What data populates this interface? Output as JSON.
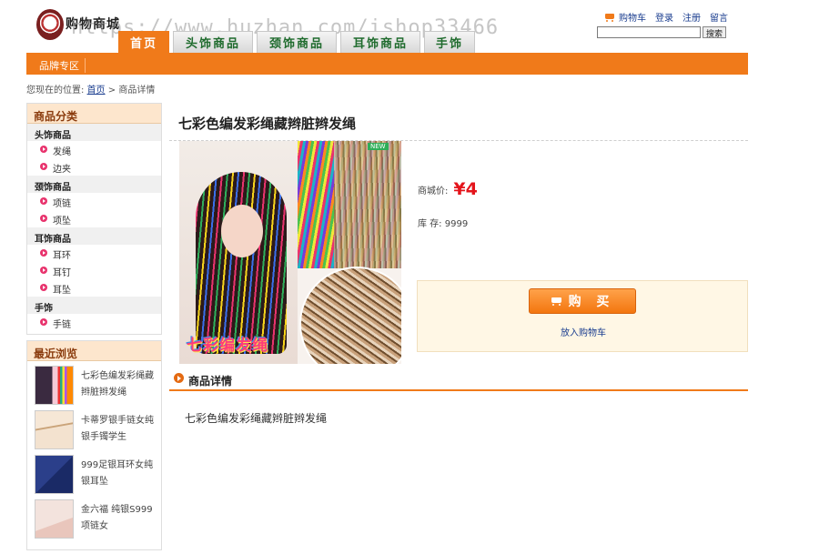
{
  "header": {
    "brand": "购物商城",
    "watermark": "https://www.huzhan.com/ishop33466",
    "links": {
      "cart": "购物车",
      "login": "登录",
      "register": "注册",
      "message": "留言"
    },
    "search_button": "搜索"
  },
  "nav": {
    "tabs": [
      {
        "label": "首页",
        "active": true
      },
      {
        "label": "头饰商品"
      },
      {
        "label": "颈饰商品"
      },
      {
        "label": "耳饰商品"
      },
      {
        "label": "手饰"
      }
    ],
    "subnav": "品牌专区"
  },
  "breadcrumb": {
    "prefix": "您现在的位置:",
    "home": "首页",
    "sep": ">",
    "current": "商品详情"
  },
  "sidebar": {
    "category_title": "商品分类",
    "groups": [
      {
        "name": "头饰商品",
        "items": [
          "发绳",
          "边夹"
        ]
      },
      {
        "name": "颈饰商品",
        "items": [
          "项链",
          "项坠"
        ]
      },
      {
        "name": "耳饰商品",
        "items": [
          "耳环",
          "耳钉",
          "耳坠"
        ]
      },
      {
        "name": "手饰",
        "items": [
          "手链"
        ]
      }
    ],
    "recent_title": "最近浏览",
    "recent": [
      "七彩色编发彩绳藏辫脏辫发绳",
      "卡蒂罗银手链女纯银手镯学生",
      "999足银耳环女纯银耳坠",
      "金六福 纯银S999项链女"
    ]
  },
  "product": {
    "title": "七彩色编发彩绳藏辫脏辫发绳",
    "image_caption": "七彩编发绳",
    "image_badge": "NEW",
    "price_label": "商城价:",
    "price": "¥4",
    "stock": "库 存: 9999",
    "buy_button": "购 买",
    "add_to_cart": "放入购物车"
  },
  "details": {
    "title": "商品详情",
    "text": "七彩色编发彩绳藏辫脏辫发绳"
  },
  "colors": {
    "accent": "#f07a1a",
    "price": "#e4141b",
    "nav_text": "#1f6b2d"
  }
}
